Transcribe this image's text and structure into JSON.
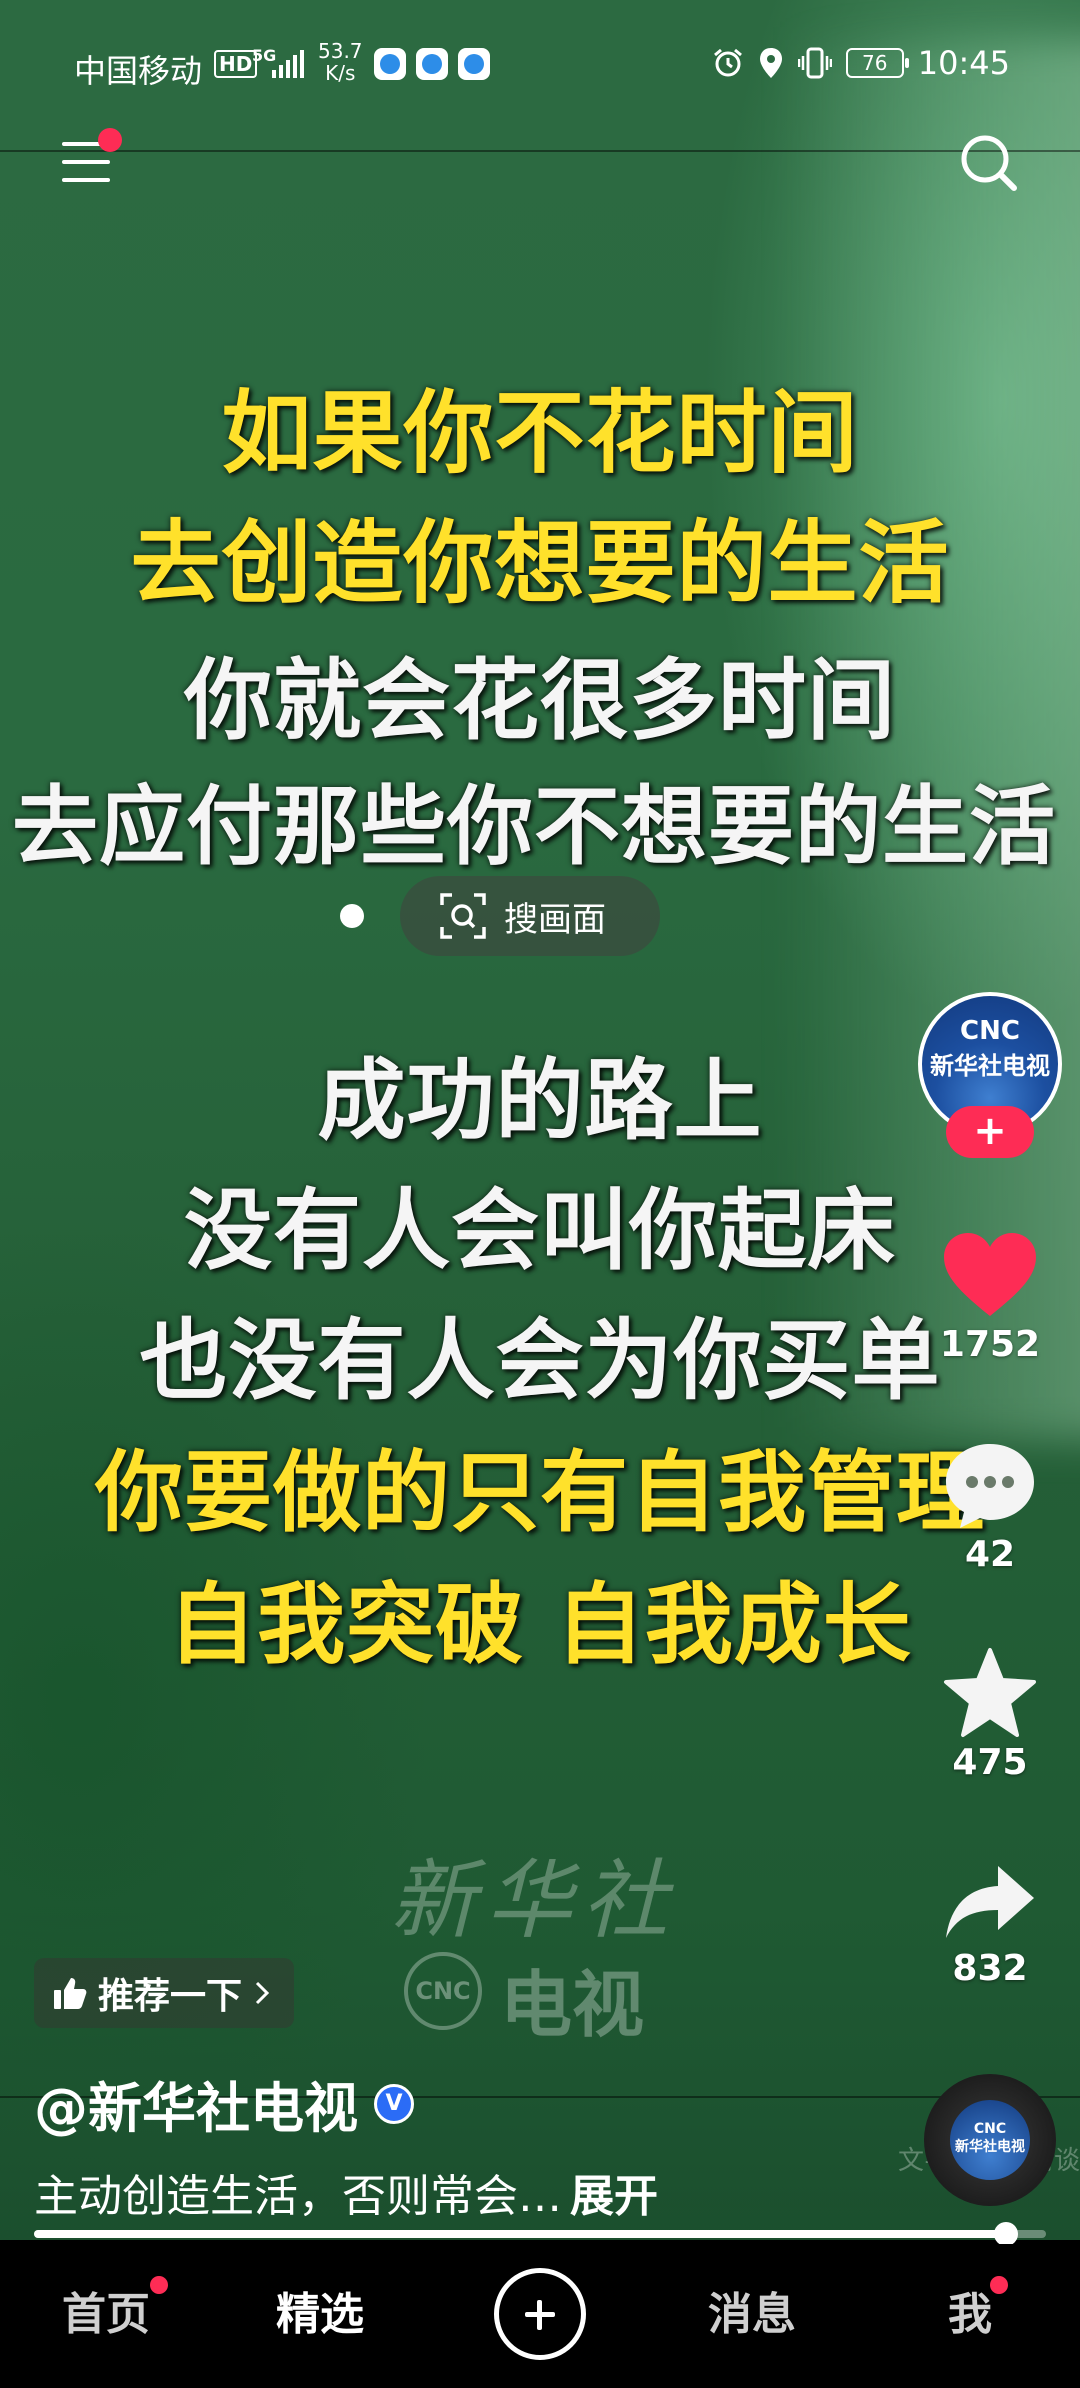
{
  "status_bar": {
    "carrier": "中国移动",
    "hd": "HD",
    "network": "5G",
    "speed_value": "53.7",
    "speed_unit": "K/s",
    "battery": "76",
    "time": "10:45"
  },
  "video": {
    "subtitle_lines": [
      "如果你不花时间",
      "去创造你想要的生活",
      "你就会花很多时间",
      "去应付那些你不想要的生活",
      "成功的路上",
      "没有人会叫你起床",
      "也没有人会为你买单",
      "你要做的只有自我管理",
      "自我突破 自我成长"
    ],
    "watermark_top": "新华社",
    "watermark_logo": "CNC",
    "watermark_bottom": "电视",
    "watermark_source": "文字来源：清谈"
  },
  "search_frame_label": "搜画面",
  "creator": {
    "avatar_line1": "CNC",
    "avatar_line2": "新华社电视",
    "follow_symbol": "+"
  },
  "actions": {
    "likes": "1752",
    "comments": "42",
    "favorites": "475",
    "shares": "832"
  },
  "music_disc": {
    "line1": "CNC",
    "line2": "新华社电视"
  },
  "recommend_chip": "推荐一下",
  "author_name": "@新华社电视",
  "verified_mark": "V",
  "description": "主动创造生活，否则常会…",
  "expand_label": "展开",
  "playback_progress": 0.96,
  "tabs": [
    "首页",
    "精选",
    "消息",
    "我"
  ],
  "colors": {
    "accent_red": "#fe2c55",
    "subtitle_yellow": "#ffe12b",
    "verified_blue": "#2b6cf6"
  }
}
